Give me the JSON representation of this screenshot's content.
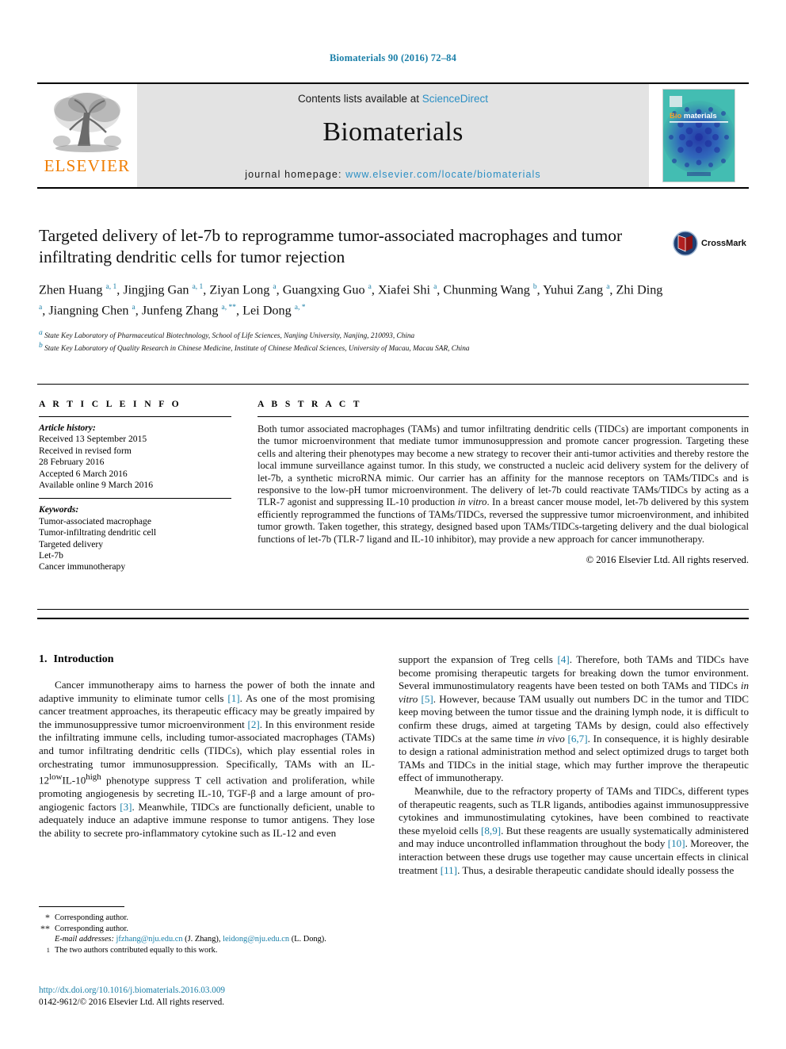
{
  "running_head": "Biomaterials 90 (2016) 72–84",
  "masthead": {
    "publisher_logo_text": "ELSEVIER",
    "contents_prefix": "Contents lists available at ",
    "contents_link": "ScienceDirect",
    "journal_name": "Biomaterials",
    "homepage_prefix": "journal homepage: ",
    "homepage_url": "www.elsevier.com/locate/biomaterials",
    "cover_title_first": "Bio",
    "cover_title_rest": "materials",
    "colors": {
      "link_blue": "#2b8fc4",
      "elsevier_orange": "#f07d00",
      "panel_gray": "#e3e3e3",
      "cover_teal": "#3fb7ab",
      "cover_blue": "#2433a6"
    }
  },
  "article": {
    "title": "Targeted delivery of let-7b to reprogramme tumor-associated macrophages and tumor infiltrating dendritic cells for tumor rejection",
    "crossmark_label": "CrossMark",
    "authors_html": "Zhen Huang <sup>a, 1</sup>, Jingjing Gan <sup>a, 1</sup>, Ziyan Long <sup>a</sup>, Guangxing Guo <sup>a</sup>, Xiafei Shi <sup>a</sup>, Chunming Wang <sup>b</sup>, Yuhui Zang <sup>a</sup>, Zhi Ding <sup>a</sup>, Jiangning Chen <sup>a</sup>, Junfeng Zhang <sup>a, **</sup>, Lei Dong <sup>a, *</sup>",
    "affiliations": [
      {
        "mark": "a",
        "text": "State Key Laboratory of Pharmaceutical Biotechnology, School of Life Sciences, Nanjing University, Nanjing, 210093, China"
      },
      {
        "mark": "b",
        "text": "State Key Laboratory of Quality Research in Chinese Medicine, Institute of Chinese Medical Sciences, University of Macau, Macau SAR, China"
      }
    ]
  },
  "article_info": {
    "heading": "A R T I C L E  I N F O",
    "history_label": "Article history:",
    "history": [
      "Received 13 September 2015",
      "Received in revised form",
      "28 February 2016",
      "Accepted 6 March 2016",
      "Available online 9 March 2016"
    ],
    "keywords_label": "Keywords:",
    "keywords": [
      "Tumor-associated macrophage",
      "Tumor-infiltrating dendritic cell",
      "Targeted delivery",
      "Let-7b",
      "Cancer immunotherapy"
    ]
  },
  "abstract": {
    "heading": "A B S T R A C T",
    "body_html": "Both tumor associated macrophages (TAMs) and tumor infiltrating dendritic cells (TIDCs) are important components in the tumor microenvironment that mediate tumor immunosuppression and promote cancer progression. Targeting these cells and altering their phenotypes may become a new strategy to recover their anti-tumor activities and thereby restore the local immune surveillance against tumor. In this study, we constructed a nucleic acid delivery system for the delivery of let-7b, a synthetic microRNA mimic. Our carrier has an affinity for the mannose receptors on TAMs/TIDCs and is responsive to the low-pH tumor microenvironment. The delivery of let-7b could reactivate TAMs/TIDCs by acting as a TLR-7 agonist and suppressing IL-10 production <span class=\"it\">in vitro</span>. In a breast cancer mouse model, let-7b delivered by this system efficiently reprogrammed the functions of TAMs/TIDCs, reversed the suppressive tumor microenvironment, and inhibited tumor growth. Taken together, this strategy, designed based upon TAMs/TIDCs-targeting delivery and the dual biological functions of let-7b (TLR-7 ligand and IL-10 inhibitor), may provide a new approach for cancer immunotherapy.",
    "copyright": "© 2016 Elsevier Ltd. All rights reserved."
  },
  "introduction": {
    "section_number": "1.",
    "section_title": "Introduction",
    "left_paragraph_html": "Cancer immunotherapy aims to harness the power of both the innate and adaptive immunity to eliminate tumor cells <span class=\"ref\">[1]</span>. As one of the most promising cancer treatment approaches, its therapeutic efficacy may be greatly impaired by the immunosuppressive tumor microenvironment <span class=\"ref\">[2]</span>. In this environment reside the infiltrating immune cells, including tumor-associated macrophages (TAMs) and tumor infiltrating dendritic cells (TIDCs), which play essential roles in orchestrating tumor immunosuppression. Specifically, TAMs with an IL-12<sup>low</sup>IL-10<sup>high</sup> phenotype suppress T cell activation and proliferation, while promoting angiogenesis by secreting IL-10, TGF-β and a large amount of pro-angiogenic factors <span class=\"ref\">[3]</span>. Meanwhile, TIDCs are functionally deficient, unable to adequately induce an adaptive immune response to tumor antigens. They lose the ability to secrete pro-inflammatory cytokine such as IL-12 and even",
    "right_paragraph_1_html": "support the expansion of Treg cells <span class=\"ref\">[4]</span>. Therefore, both TAMs and TIDCs have become promising therapeutic targets for breaking down the tumor environment. Several immunostimulatory reagents have been tested on both TAMs and TIDCs <span class=\"it\">in vitro</span> <span class=\"ref\">[5]</span>. However, because TAM usually out numbers DC in the tumor and TIDC keep moving between the tumor tissue and the draining lymph node, it is difficult to confirm these drugs, aimed at targeting TAMs by design, could also effectively activate TIDCs at the same time <span class=\"it\">in vivo</span> <span class=\"ref\">[6,7]</span>. In consequence, it is highly desirable to design a rational administration method and select optimized drugs to target both TAMs and TIDCs in the initial stage, which may further improve the therapeutic effect of immunotherapy.",
    "right_paragraph_2_html": "Meanwhile, due to the refractory property of TAMs and TIDCs, different types of therapeutic reagents, such as TLR ligands, antibodies against immunosuppressive cytokines and immunostimulating cytokines, have been combined to reactivate these myeloid cells <span class=\"ref\">[8,9]</span>. But these reagents are usually systematically administered and may induce uncontrolled inflammation throughout the body <span class=\"ref\">[10]</span>. Moreover, the interaction between these drugs use together may cause uncertain effects in clinical treatment <span class=\"ref\">[11]</span>. Thus, a desirable therapeutic candidate should ideally possess the"
  },
  "footnotes": [
    {
      "mark": "*",
      "text_html": "Corresponding author."
    },
    {
      "mark": "**",
      "text_html": "Corresponding author."
    },
    {
      "mark": "",
      "text_html": "<span class=\"fn-em\">E-mail addresses:</span> <span class=\"link\">jfzhang@nju.edu.cn</span> (J. Zhang), <span class=\"link\">leidong@nju.edu.cn</span> (L. Dong)."
    },
    {
      "mark": "1",
      "text_html": "The two authors contributed equally to this work."
    }
  ],
  "publication": {
    "doi_url": "http://dx.doi.org/10.1016/j.biomaterials.2016.03.009",
    "issn_line": "0142-9612/© 2016 Elsevier Ltd. All rights reserved."
  }
}
